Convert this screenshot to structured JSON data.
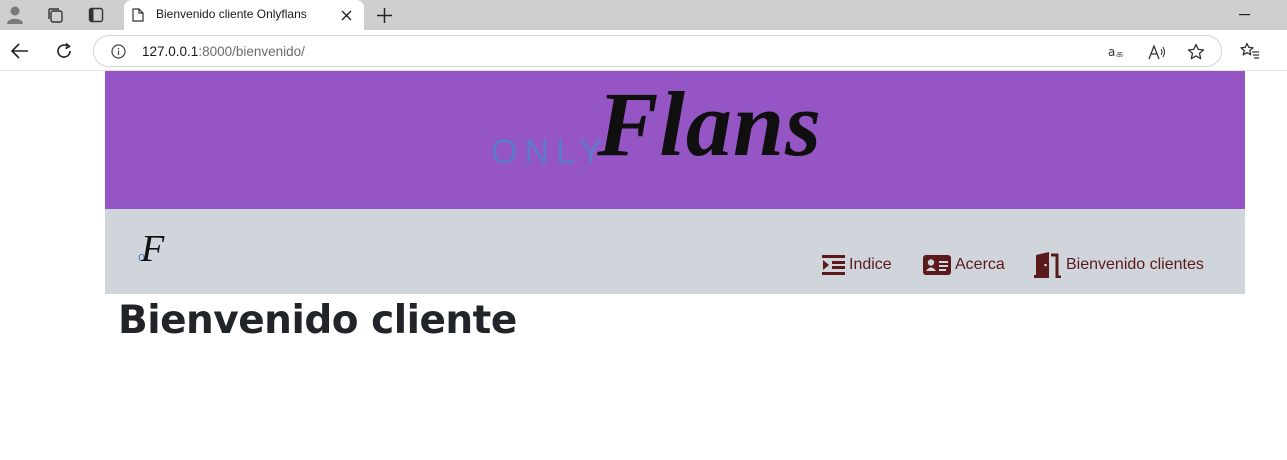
{
  "browser": {
    "tab_title": "Bienvenido cliente Onlyflans",
    "url_host": "127.0.0.1",
    "url_rest": ":8000/bienvenido/"
  },
  "banner": {
    "logo_only": "ONLY",
    "logo_flans": "Flans"
  },
  "navbar": {
    "logo_o": "o",
    "logo_f": "F",
    "items": [
      {
        "label": "Indice",
        "icon": "indent-icon"
      },
      {
        "label": "Acerca",
        "icon": "id-card-icon"
      },
      {
        "label": "Bienvenido clientes",
        "icon": "door-open-icon"
      }
    ]
  },
  "main": {
    "title": "Bienvenido cliente"
  },
  "colors": {
    "banner_bg": "#9555c5",
    "navbar_bg": "#d0d4db",
    "nav_text": "#5b1a1a",
    "logo_accent": "#5c7bc9"
  }
}
